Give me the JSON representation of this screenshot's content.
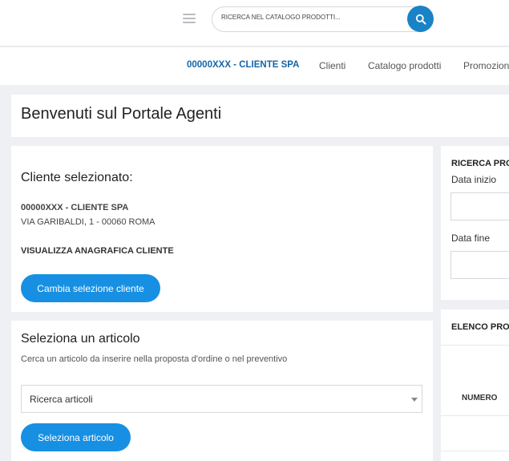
{
  "header": {
    "search_placeholder": "RICERCA NEL CATALOGO PRODOTTI..."
  },
  "nav": {
    "selected_client": "00000XXX - CLIENTE SPA",
    "items": [
      "Clienti",
      "Catalogo prodotti",
      "Promozioni"
    ]
  },
  "welcome": {
    "title": "Benvenuti sul Portale Agenti"
  },
  "client_card": {
    "title": "Cliente selezionato:",
    "code": "00000XXX - CLIENTE SPA",
    "address": "VIA GARIBALDI, 1 - 00060 ROMA",
    "view_link": "VISUALIZZA ANAGRAFICA CLIENTE",
    "change_button": "Cambia selezione cliente"
  },
  "article_card": {
    "title": "Seleziona un articolo",
    "description": "Cerca un articolo da inserire nella proposta d'ordine o nel preventivo",
    "select_value": "Ricerca articoli",
    "select_button": "Seleziona articolo"
  },
  "right_panel": {
    "search_title": "RICERCA PROPOSTE",
    "start_label": "Data inizio",
    "end_label": "Data fine",
    "list_title": "ELENCO PROPOSTE",
    "col_number": "NUMERO"
  },
  "colors": {
    "accent": "#1790e3",
    "search_button": "#1a83c6",
    "client_link": "#1565a8"
  }
}
